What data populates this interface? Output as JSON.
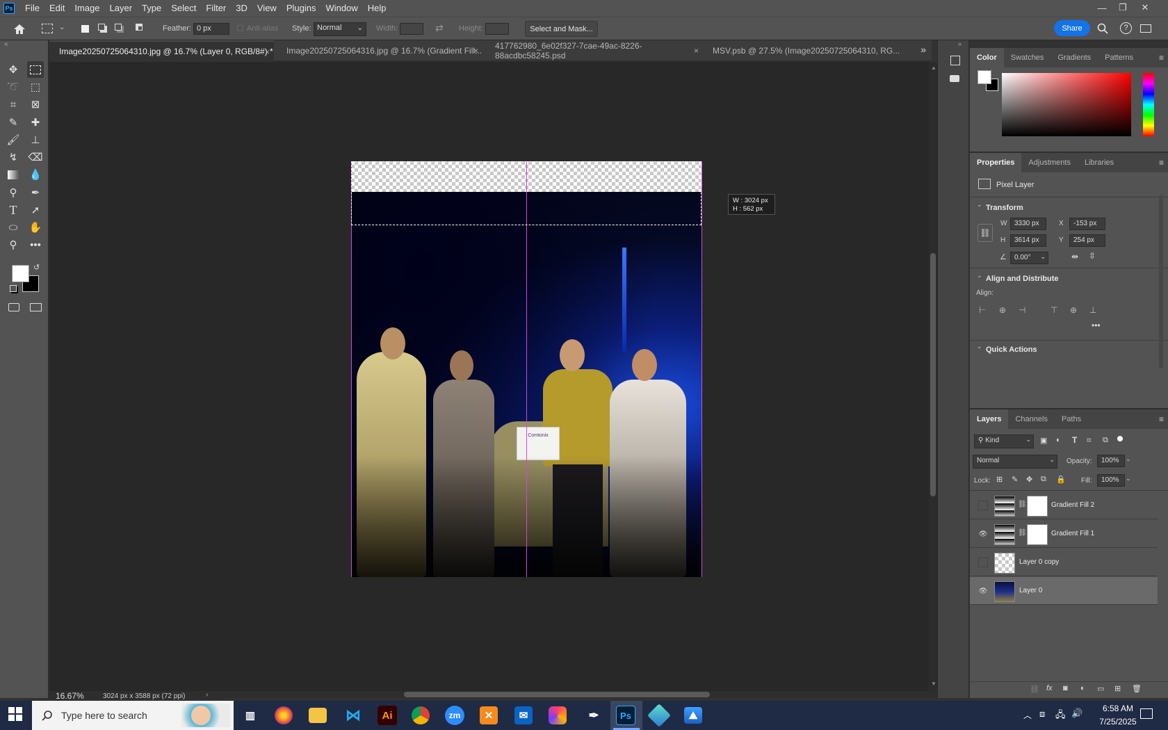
{
  "menu": [
    "File",
    "Edit",
    "Image",
    "Layer",
    "Type",
    "Select",
    "Filter",
    "3D",
    "View",
    "Plugins",
    "Window",
    "Help"
  ],
  "app_logo": "Ps",
  "options": {
    "feather_label": "Feather:",
    "feather_value": "0 px",
    "antialias_label": "Anti-alias",
    "style_label": "Style:",
    "style_value": "Normal",
    "width_label": "Width:",
    "height_label": "Height:",
    "select_mask": "Select and Mask...",
    "share": "Share"
  },
  "tabs": [
    {
      "label": "Image20250725064310.jpg @ 16.7% (Layer 0, RGB/8#) *"
    },
    {
      "label": "Image20250725064316.jpg @ 16.7% (Gradient Fill..."
    },
    {
      "label": "417762980_6e02f327-7cae-49ac-8226-88acdbc58245.psd"
    },
    {
      "label": "MSV.psb @ 27.5% (Image20250725064310, RG..."
    }
  ],
  "canvas": {
    "tooltip_w": "W :  3024 px",
    "tooltip_h": "H :   562 px",
    "badge_text": "Comtonix"
  },
  "status": {
    "zoom": "16.67%",
    "doc_info": "3024 px x 3588 px (72 ppi)"
  },
  "color_panel": {
    "tabs": [
      "Color",
      "Swatches",
      "Gradients",
      "Patterns"
    ]
  },
  "properties": {
    "tabs": [
      "Properties",
      "Adjustments",
      "Libraries"
    ],
    "layer_type": "Pixel Layer",
    "transform_title": "Transform",
    "w_label": "W",
    "w": "3330 px",
    "x_label": "X",
    "x": "-153 px",
    "h_label": "H",
    "h": "3614 px",
    "y_label": "Y",
    "y": "254 px",
    "angle": "0.00°",
    "align_title": "Align and Distribute",
    "align_label": "Align:",
    "quick_title": "Quick Actions"
  },
  "layers_panel": {
    "tabs": [
      "Layers",
      "Channels",
      "Paths"
    ],
    "kind": "Kind",
    "blend": "Normal",
    "opacity_label": "Opacity:",
    "opacity": "100%",
    "lock_label": "Lock:",
    "fill_label": "Fill:",
    "fill": "100%",
    "layers": [
      {
        "name": "Gradient Fill 2",
        "visible": false
      },
      {
        "name": "Gradient Fill 1",
        "visible": true
      },
      {
        "name": "Layer 0 copy",
        "visible": false
      },
      {
        "name": "Layer 0",
        "visible": true
      }
    ]
  },
  "taskbar": {
    "search_placeholder": "Type here to search",
    "time": "6:58 AM",
    "date": "7/25/2025",
    "apps": [
      "Ai",
      "zm",
      "Ps"
    ]
  }
}
